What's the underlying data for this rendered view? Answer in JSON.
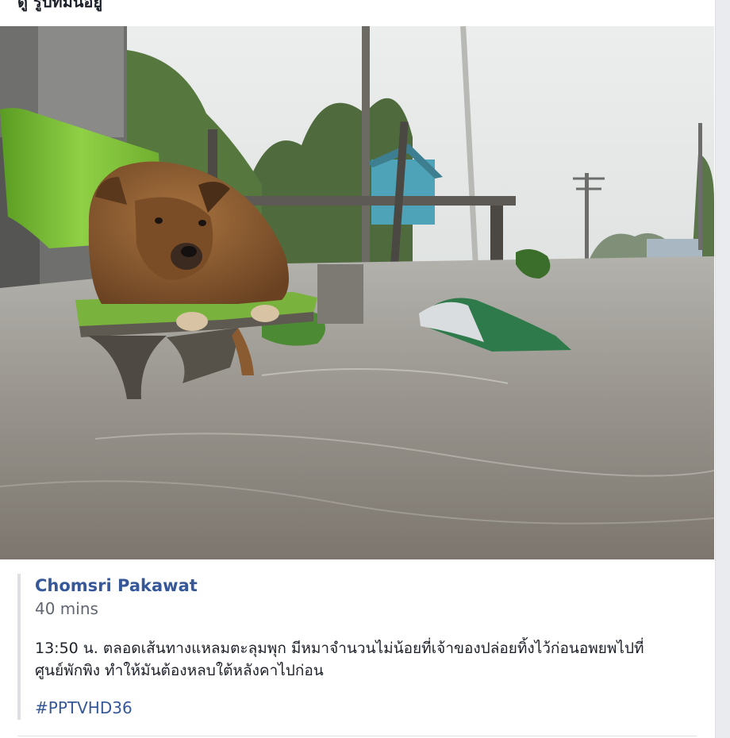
{
  "page": {
    "header_title": "ดู รูปที่มีนี่อยู่"
  },
  "photo": {
    "subject": "dog-on-bench-flood",
    "colors": {
      "sky": "#e4e6e6",
      "water": "#8d8983",
      "bench": "#7fbf3a",
      "dog": "#8a5a30"
    }
  },
  "post": {
    "author": "Chomsri Pakawat",
    "time": "40 mins",
    "text_line1": "13:50 น. ตลอดเส้นทางแหลมตะลุมพุก มีหมาจำนวนไม่น้อยที่เจ้าของปล่อยทิ้งไว้ก่อนอพยพไปที่",
    "text_line2": "ศูนย์พักพิง ทำให้มันต้องหลบใต้หลังคาไปก่อน",
    "hashtag": "#PPTVHD36"
  },
  "colors": {
    "link": "#365899",
    "text": "#1d2129",
    "muted": "#616770",
    "border": "#dddfe2"
  }
}
